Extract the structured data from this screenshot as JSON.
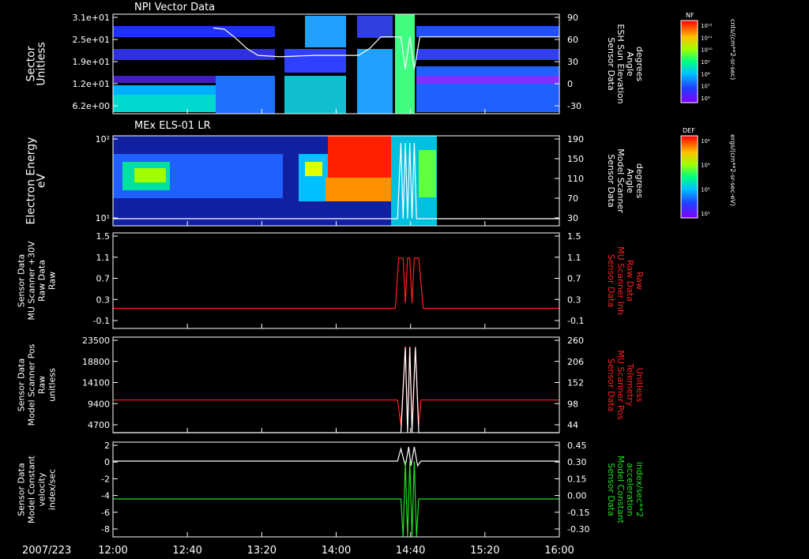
{
  "time_axis": {
    "date": "2007/223",
    "ticks": [
      "12:00",
      "12:40",
      "13:20",
      "14:00",
      "14:40",
      "15:20",
      "16:00"
    ],
    "tick_hours": [
      12.0,
      12.6667,
      13.3333,
      14.0,
      14.6667,
      15.3333,
      16.0
    ]
  },
  "panels": [
    {
      "id": "npi",
      "title": "NPI Vector Data",
      "left_label": [
        "Sector",
        "Unitless"
      ],
      "left_ticks": [
        "3.1e+01",
        "2.5e+01",
        "1.9e+01",
        "1.2e+01",
        "6.2e+00"
      ],
      "right_label": [
        "Sensor Data",
        "ESH Sun Elevation",
        "Angle",
        "degrees"
      ],
      "right_label_color": "#ffffff",
      "right_ticks": [
        "90",
        "60",
        "30",
        "0",
        "-30"
      ],
      "right_range": [
        -55,
        90
      ],
      "colorbar": {
        "title": "NF",
        "units": "cnts/(cm**2-sr-sec)",
        "ticks": [
          "10¹²",
          "10¹¹",
          "10¹⁰",
          "10⁹",
          "10⁸",
          "10⁷",
          "10⁶"
        ]
      }
    },
    {
      "id": "els",
      "title": "MEx ELS-01 LR",
      "left_label": [
        "Electron Energy",
        "eV"
      ],
      "left_ticks": [
        "10²",
        "10¹"
      ],
      "right_label": [
        "Sensor Data",
        "Model Scanner",
        "Angle",
        "degrees"
      ],
      "right_label_color": "#ffffff",
      "right_ticks": [
        "190",
        "150",
        "110",
        "70",
        "30"
      ],
      "right_range": [
        0,
        190
      ],
      "colorbar": {
        "title": "DEF",
        "units": "ergs/(cm**2-sr-sec-eV)",
        "ticks": [
          "10⁴",
          "10³",
          "10²",
          "10¹"
        ]
      }
    },
    {
      "id": "mu_raw",
      "left_label": [
        "Sensor Data",
        "MU Scanner +30V",
        "Raw Data",
        "Raw"
      ],
      "left_ticks": [
        "1.5",
        "1.1",
        "0.7",
        "0.3",
        "-0.1"
      ],
      "left_range": [
        -0.4,
        1.5
      ],
      "right_label": [
        "Sensor Data",
        "MU Scanner Inh",
        "Raw Data",
        "Raw"
      ],
      "right_label_color": "#ff2020",
      "right_ticks": [
        "1.5",
        "1.1",
        "0.7",
        "0.3",
        "-0.1"
      ],
      "right_range": [
        -0.4,
        1.5
      ]
    },
    {
      "id": "scan_pos",
      "left_label": [
        "Sensor Data",
        "Model Scanner Pos",
        "Raw",
        "unitless"
      ],
      "left_ticks": [
        "23500",
        "18800",
        "14100",
        "9400",
        "4700"
      ],
      "left_range": [
        0,
        23500
      ],
      "right_label": [
        "Sensor Data",
        "MU Scanner Pos",
        "Telemetry",
        "Unitless"
      ],
      "right_label_color": "#ff2020",
      "right_ticks": [
        "260",
        "206",
        "152",
        "98",
        "44"
      ],
      "right_range": [
        0,
        260
      ]
    },
    {
      "id": "velocity",
      "left_label": [
        "Sensor Data",
        "Model Constant",
        "velocity",
        "index/sec"
      ],
      "left_ticks": [
        "2",
        "0",
        "-2",
        "-4",
        "-6",
        "-8"
      ],
      "left_range": [
        -8,
        2
      ],
      "right_label": [
        "Sensor Data",
        "Model Constant",
        "acceleration",
        "index/sec**2"
      ],
      "right_label_color": "#20e020",
      "right_ticks": [
        "0.45",
        "0.30",
        "0.15",
        "0.00",
        "-0.15",
        "-0.30"
      ],
      "right_range": [
        -0.3,
        0.45
      ]
    }
  ],
  "chart_data": [
    {
      "type": "heatmap",
      "panel": "npi",
      "title": "NPI Vector Data",
      "ylabel": "Sector Unitless",
      "y_ticks": [
        31,
        25,
        19,
        12,
        6.2
      ],
      "overlay_series": {
        "name": "ESH Sun Elevation Angle",
        "color": "#ffffff",
        "x": [
          12.9,
          13.0,
          13.1,
          13.2,
          13.3,
          13.5,
          13.8,
          14.2,
          14.3,
          14.4,
          14.58,
          14.62,
          14.66,
          14.7,
          14.75,
          15.2,
          16.0
        ],
        "y": [
          70,
          68,
          55,
          40,
          30,
          28,
          30,
          30,
          40,
          57,
          57,
          10,
          57,
          10,
          57,
          57,
          57
        ]
      },
      "colorbar_range": [
        "10⁶",
        "10¹²"
      ]
    },
    {
      "type": "heatmap",
      "panel": "els",
      "title": "MEx ELS-01 LR",
      "ylabel": "Electron Energy eV",
      "y_scale": "log",
      "overlay_series": {
        "name": "Model Scanner Angle",
        "color": "#ffffff",
        "x": [
          12.0,
          14.55,
          14.58,
          14.6,
          14.62,
          14.64,
          14.66,
          14.68,
          14.7,
          14.72,
          14.75,
          16.0
        ],
        "y": [
          15,
          15,
          175,
          15,
          175,
          15,
          175,
          15,
          175,
          15,
          15,
          15
        ]
      },
      "colorbar_range": [
        "10¹",
        "10⁴"
      ]
    },
    {
      "type": "line",
      "panel": "mu_raw",
      "series": [
        {
          "name": "MU Scanner Inh Raw Data",
          "color": "#ff2020",
          "x": [
            12.0,
            14.53,
            14.56,
            14.6,
            14.62,
            14.64,
            14.66,
            14.68,
            14.7,
            14.72,
            14.74,
            14.78,
            16.0
          ],
          "y": [
            0.0,
            0.0,
            1.0,
            1.0,
            0.1,
            1.0,
            1.0,
            0.1,
            1.0,
            1.0,
            1.0,
            0.0,
            0.0
          ]
        }
      ]
    },
    {
      "type": "line",
      "panel": "scan_pos",
      "series": [
        {
          "name": "MU Scanner Pos Telemetry",
          "color": "#ff2020",
          "x": [
            12.0,
            14.55,
            14.58,
            14.62,
            14.64,
            14.66,
            14.68,
            14.71,
            14.74,
            14.76,
            16.0
          ],
          "y": [
            89,
            89,
            20,
            235,
            20,
            235,
            20,
            235,
            20,
            89,
            89
          ]
        },
        {
          "name": "Model Scanner Pos Raw",
          "color": "#ffffff",
          "x": [
            12.0,
            14.55,
            14.58,
            14.62,
            14.64,
            14.66,
            14.68,
            14.71,
            14.74,
            14.76,
            16.0
          ],
          "y": [
            0,
            0,
            0,
            21000,
            0,
            21000,
            0,
            21000,
            0,
            0,
            0
          ]
        }
      ]
    },
    {
      "type": "line",
      "panel": "velocity",
      "series": [
        {
          "name": "Model Constant velocity",
          "color": "#ffffff",
          "x": [
            12.0,
            14.55,
            14.58,
            14.62,
            14.65,
            14.67,
            14.7,
            14.73,
            14.76,
            16.0
          ],
          "y": [
            0,
            0,
            1.3,
            -0.5,
            1.5,
            -0.5,
            1.5,
            -0.5,
            0,
            0
          ]
        },
        {
          "name": "Model Constant acceleration",
          "color": "#20e020",
          "axis": "right",
          "x": [
            12.0,
            14.58,
            14.6,
            14.62,
            14.64,
            14.66,
            14.68,
            14.7,
            14.72,
            14.74,
            16.0
          ],
          "y": [
            0.0,
            0.0,
            -0.3,
            0.3,
            -0.3,
            0.3,
            -0.3,
            0.3,
            -0.3,
            0.0,
            0.0
          ]
        }
      ]
    }
  ]
}
